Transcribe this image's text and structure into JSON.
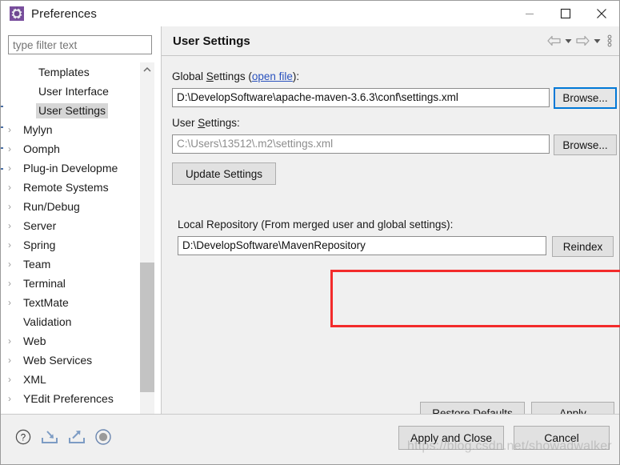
{
  "window": {
    "title": "Preferences",
    "icon": "preferences-gear-icon",
    "minimize_label": "Minimize",
    "maximize_label": "Maximize",
    "close_label": "Close"
  },
  "sidebar": {
    "filter": {
      "placeholder": "type filter text",
      "value": ""
    },
    "items": [
      {
        "label": "Templates",
        "level": "child",
        "expandable": false,
        "selected": false
      },
      {
        "label": "User Interface",
        "level": "child",
        "expandable": false,
        "selected": false
      },
      {
        "label": "User Settings",
        "level": "child",
        "expandable": false,
        "selected": true
      },
      {
        "label": "Mylyn",
        "level": "top",
        "expandable": true,
        "selected": false
      },
      {
        "label": "Oomph",
        "level": "top",
        "expandable": true,
        "selected": false
      },
      {
        "label": "Plug-in Developme",
        "level": "top",
        "expandable": true,
        "selected": false
      },
      {
        "label": "Remote Systems",
        "level": "top",
        "expandable": true,
        "selected": false
      },
      {
        "label": "Run/Debug",
        "level": "top",
        "expandable": true,
        "selected": false
      },
      {
        "label": "Server",
        "level": "top",
        "expandable": true,
        "selected": false
      },
      {
        "label": "Spring",
        "level": "top",
        "expandable": true,
        "selected": false
      },
      {
        "label": "Team",
        "level": "top",
        "expandable": true,
        "selected": false
      },
      {
        "label": "Terminal",
        "level": "top",
        "expandable": true,
        "selected": false
      },
      {
        "label": "TextMate",
        "level": "top",
        "expandable": true,
        "selected": false
      },
      {
        "label": "Validation",
        "level": "top",
        "expandable": false,
        "selected": false
      },
      {
        "label": "Web",
        "level": "top",
        "expandable": true,
        "selected": false
      },
      {
        "label": "Web Services",
        "level": "top",
        "expandable": true,
        "selected": false
      },
      {
        "label": "XML",
        "level": "top",
        "expandable": true,
        "selected": false
      },
      {
        "label": "YEdit Preferences",
        "level": "top",
        "expandable": true,
        "selected": false
      }
    ]
  },
  "page": {
    "title": "User Settings",
    "toolbar": {
      "back": "back-arrow-icon",
      "back_menu": "back-dropdown-icon",
      "forward": "forward-arrow-icon",
      "forward_menu": "forward-dropdown-icon",
      "view_menu": "view-menu-icon"
    },
    "global_settings": {
      "label_prefix": "Global ",
      "label_mnemonic": "S",
      "label_suffix": "ettings (",
      "link_text": "open file",
      "label_end": "):",
      "value": "D:\\DevelopSoftware\\apache-maven-3.6.3\\conf\\settings.xml",
      "browse_label": "Browse..."
    },
    "user_settings": {
      "label_prefix": "User ",
      "label_mnemonic": "S",
      "label_suffix": "ettings:",
      "value": "C:\\Users\\13512\\.m2\\settings.xml",
      "browse_label": "Browse...",
      "update_label": "Update Settings"
    },
    "local_repository": {
      "label": "Local Repository (From merged user and global settings):",
      "value": "D:\\DevelopSoftware\\MavenRepository",
      "reindex_label": "Reindex",
      "highlight_color": "#f32b2b"
    },
    "restore_defaults_label": "Restore Defaults",
    "apply_label": "Apply"
  },
  "footer": {
    "icons": [
      {
        "name": "help-icon"
      },
      {
        "name": "import-icon"
      },
      {
        "name": "export-icon"
      },
      {
        "name": "record-icon"
      }
    ],
    "apply_and_close_label": "Apply and Close",
    "cancel_label": "Cancel"
  },
  "watermark": "https://blog.csdn.net/showadwalker"
}
